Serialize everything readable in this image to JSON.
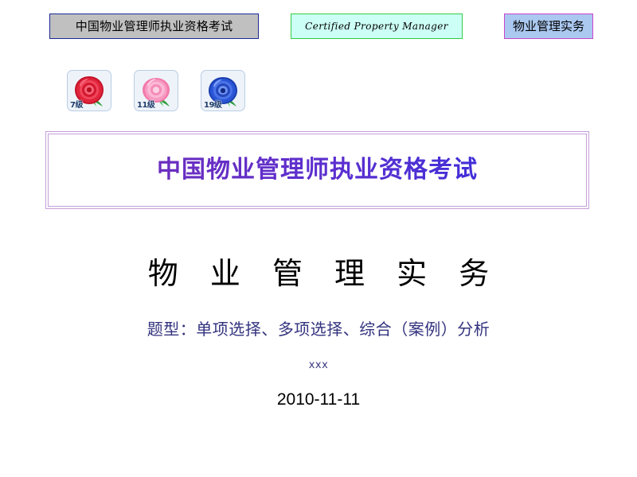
{
  "banners": [
    {
      "id": "cn-exam",
      "label": "中国物业管理师执业资格考试",
      "bg": "#c0c0c0",
      "border": "#1b2a94"
    },
    {
      "id": "cpm",
      "label": "Certified  Property  Manager",
      "bg": "#ccfff5",
      "border": "#33cc44"
    },
    {
      "id": "subject",
      "label": "物业管理实务",
      "bg": "#aac8f0",
      "border": "#cc44cc"
    }
  ],
  "badges": [
    {
      "icon": "rose-icon",
      "level": "7级",
      "color": "#d81e33"
    },
    {
      "icon": "rose-icon",
      "level": "11级",
      "color": "#f590bd"
    },
    {
      "icon": "rose-icon",
      "level": "19级",
      "color": "#2a4ecb"
    }
  ],
  "title_frame": {
    "heading": "中国物业管理师执业资格考试",
    "gradient_from": "#7d2fb8",
    "gradient_to": "#3333cc",
    "border_color": "#c49fd9"
  },
  "body": {
    "main_title": "物 业 管 理 实 务",
    "question_types": "题型：单项选择、多项选择、综合（案例）分析",
    "author": "xxx",
    "date": "2010-11-11",
    "accent_text_color": "#33337f"
  }
}
